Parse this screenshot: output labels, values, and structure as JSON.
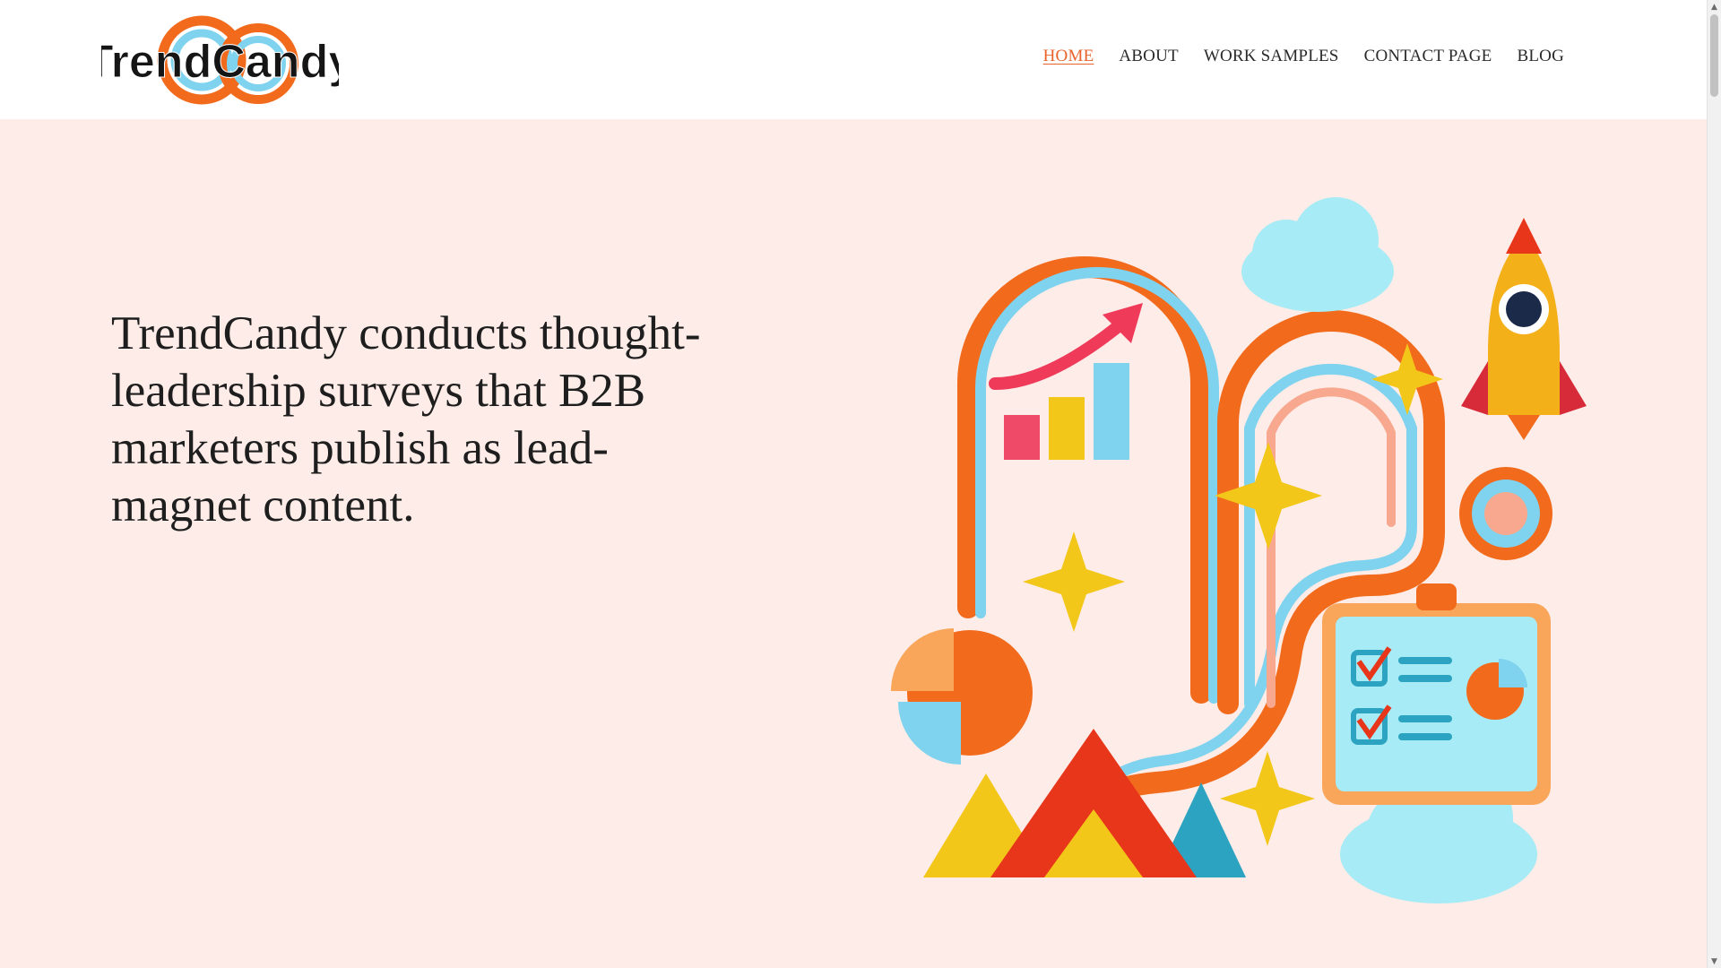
{
  "header": {
    "logo_text": "TrendCandy",
    "nav": [
      {
        "label": "HOME",
        "active": true
      },
      {
        "label": "ABOUT",
        "active": false
      },
      {
        "label": "WORK SAMPLES",
        "active": false
      },
      {
        "label": "CONTACT PAGE",
        "active": false
      },
      {
        "label": "BLOG",
        "active": false
      }
    ]
  },
  "hero": {
    "headline": "TrendCandy conducts thought-leadership surveys that B2B marketers publish as lead-magnet content."
  },
  "colors": {
    "accent": "#e8622c",
    "hero_background": "#fdece7",
    "orange": "#f26a1b",
    "sky": "#7fd3ef",
    "peach": "#f7a88e",
    "yellow": "#f3c719",
    "red": "#e8361b",
    "teal": "#2ca3c1"
  },
  "icons": [
    "rainbow-path",
    "bar-chart-icon",
    "rocket-icon",
    "cloud-icon",
    "sparkle-icon",
    "pie-chart-icon",
    "clipboard-checklist-icon",
    "target-icon",
    "mountain-icon"
  ]
}
